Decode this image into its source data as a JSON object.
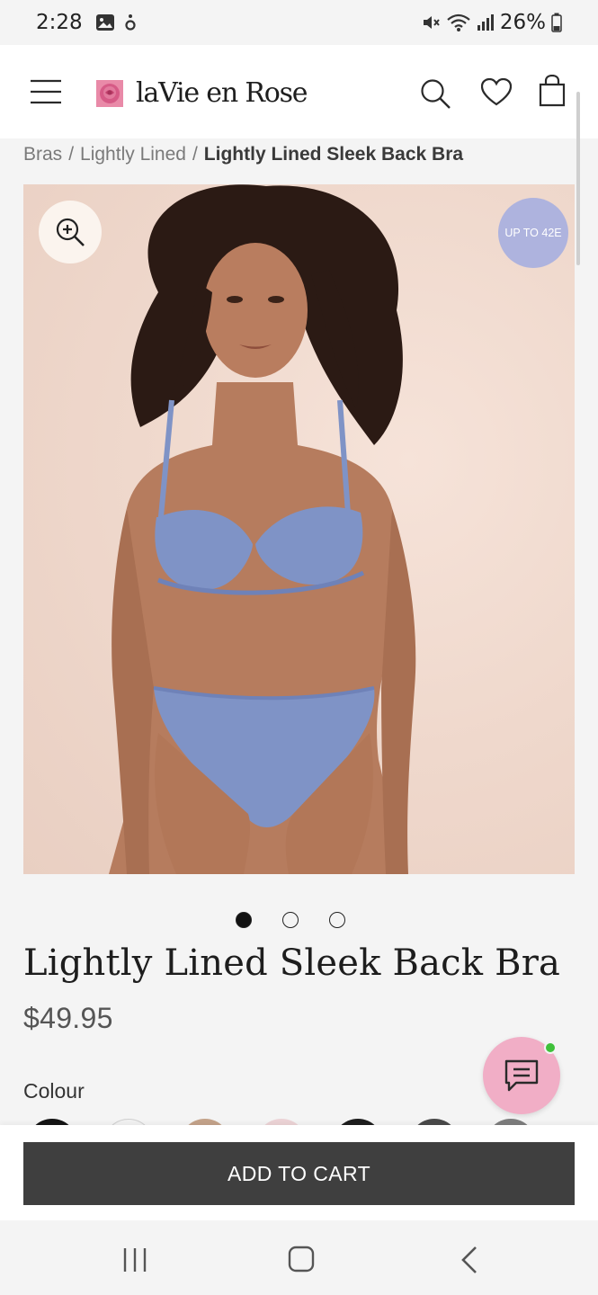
{
  "status_bar": {
    "time": "2:28",
    "battery": "26%",
    "icons": [
      "gallery-icon",
      "accessibility-icon",
      "mute-icon",
      "wifi-icon",
      "signal-icon",
      "battery-icon"
    ]
  },
  "header": {
    "brand": "laVie en Rose",
    "icons": [
      "menu-icon",
      "rose-logo-icon",
      "search-icon",
      "heart-icon",
      "shopping-bag-icon"
    ]
  },
  "breadcrumb": {
    "items": [
      "Bras",
      "Lightly Lined"
    ],
    "current": "Lightly Lined Sleek Back Bra"
  },
  "product": {
    "badge": "UP TO 42E",
    "title": "Lightly Lined Sleek Back Bra",
    "price": "$49.95",
    "colour_label": "Colour",
    "image_count": 3,
    "active_image_index": 0,
    "swatch_colors": [
      "#151515",
      "#f2f2f2",
      "#c4a38a",
      "#ecd3d6",
      "#1e1e1e",
      "#4a4a4a",
      "#7d7d7d"
    ]
  },
  "actions": {
    "add_to_cart": "ADD TO CART"
  },
  "colors": {
    "accent_badge": "#aeb3de",
    "chat_button": "#f1aec6",
    "online_dot": "#3fc13a",
    "cart_button": "#3f3f3f",
    "garment": "#7f93c6"
  },
  "nav_bar": {
    "icons": [
      "recent-apps-icon",
      "home-icon",
      "back-icon"
    ]
  }
}
